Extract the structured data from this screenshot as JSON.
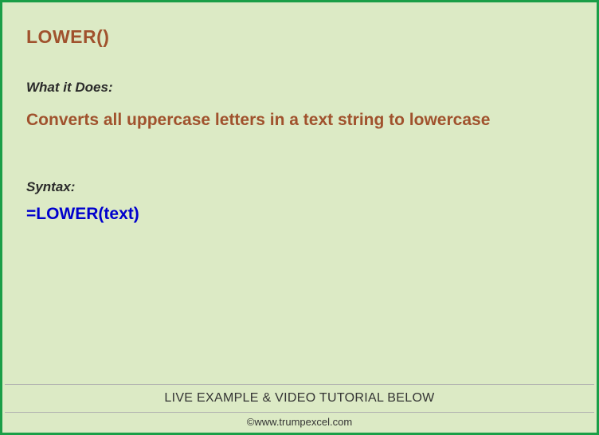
{
  "title": "LOWER()",
  "whatItDoes": {
    "label": "What it Does:",
    "description": "Converts all uppercase letters in a text string to lowercase"
  },
  "syntax": {
    "label": "Syntax:",
    "formula": "=LOWER(text)"
  },
  "footer": {
    "topText": "LIVE EXAMPLE & VIDEO TUTORIAL BELOW",
    "bottomText": "©www.trumpexcel.com"
  }
}
